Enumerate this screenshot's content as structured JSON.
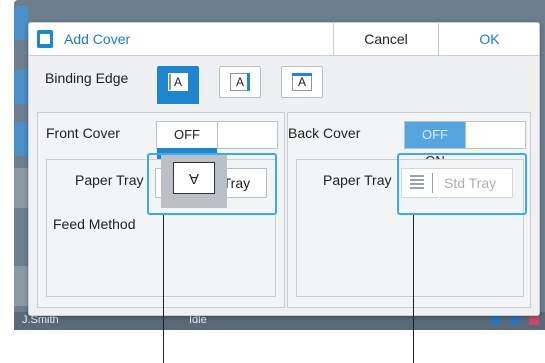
{
  "dialog": {
    "title": "Add Cover",
    "cancel_label": "Cancel",
    "ok_label": "OK"
  },
  "binding_edge": {
    "label": "Binding Edge",
    "options": [
      {
        "glyph": "A",
        "selected": true
      },
      {
        "glyph": "A",
        "selected": false
      },
      {
        "glyph": "A",
        "selected": false
      }
    ]
  },
  "front_cover": {
    "label": "Front Cover",
    "off_label": "OFF",
    "on_label": "ON",
    "state": "ON",
    "paper_tray_label": "Paper Tray",
    "tray_value": "Std Tray",
    "feed_method_label": "Feed Method",
    "feed_glyph": "A"
  },
  "back_cover": {
    "label": "Back Cover",
    "off_label": "OFF",
    "on_label": "ON",
    "state": "OFF",
    "paper_tray_label": "Paper Tray",
    "tray_value": "Std Tray"
  },
  "background": {
    "user": "J.Smith",
    "status": "Idle"
  },
  "colors": {
    "accent": "#1d86cf",
    "highlight": "#3ca9e8"
  }
}
